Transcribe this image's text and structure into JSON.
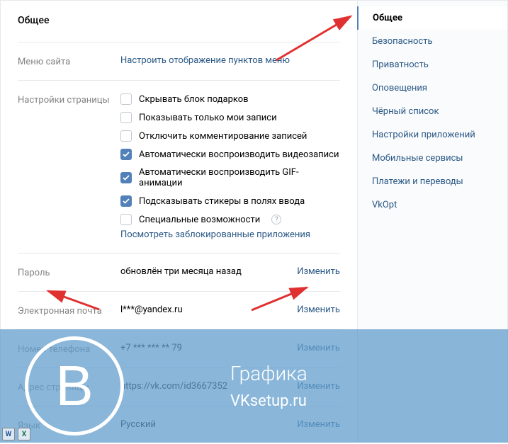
{
  "page_title": "Общее",
  "menu": {
    "label": "Меню сайта",
    "link": "Настроить отображение пунктов меню"
  },
  "page_settings": {
    "label": "Настройки страницы",
    "options": [
      {
        "text": "Скрывать блок подарков",
        "checked": false
      },
      {
        "text": "Показывать только мои записи",
        "checked": false
      },
      {
        "text": "Отключить комментирование записей",
        "checked": false
      },
      {
        "text": "Автоматически воспроизводить видеозаписи",
        "checked": true
      },
      {
        "text": "Автоматически воспроизводить GIF-анимации",
        "checked": true
      },
      {
        "text": "Подсказывать стикеры в полях ввода",
        "checked": true
      },
      {
        "text": "Специальные возможности",
        "checked": false,
        "help": true
      }
    ],
    "blocked_link": "Посмотреть заблокированные приложения"
  },
  "password": {
    "label": "Пароль",
    "value": "обновлён три месяца назад",
    "action": "Изменить"
  },
  "email": {
    "label": "Электронная почта",
    "value": "l***@yandex.ru",
    "action": "Изменить"
  },
  "phone": {
    "label": "Номер телефона",
    "value": "+7 *** *** ** 79",
    "action": "Изменить"
  },
  "address": {
    "label": "Адрес страницы",
    "value": "https://vk.com/id3667352",
    "action": "Изменить"
  },
  "language": {
    "label": "Язык",
    "value": "Русский",
    "action": "Изменить"
  },
  "sidebar": {
    "items": [
      "Общее",
      "Безопасность",
      "Приватность",
      "Оповещения",
      "Чёрный список",
      "Настройки приложений",
      "Мобильные сервисы",
      "Платежи и переводы",
      "VkOpt"
    ],
    "active_index": 0
  },
  "overlay": {
    "letter": "В",
    "title": "Графика",
    "subtitle": "VKsetup.ru"
  }
}
